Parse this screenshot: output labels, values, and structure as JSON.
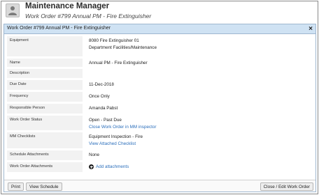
{
  "app": {
    "title": "Maintenance Manager",
    "subtitle": "Work Order #799 Annual PM - Fire Extinguisher"
  },
  "dialog": {
    "title": "Work Order #799 Annual PM - Fire Extinguisher",
    "close_label": "×"
  },
  "fields": {
    "equipment": {
      "label": "Equipment",
      "line1": "8080 Fire Extinguisher 01",
      "line2": "Department Facilities/Maintenance"
    },
    "name": {
      "label": "Name",
      "value": "Annual PM - Fire Extinguisher"
    },
    "description": {
      "label": "Description",
      "value": ""
    },
    "due_date": {
      "label": "Due Date",
      "value": "11-Dec-2018"
    },
    "frequency": {
      "label": "Frequency",
      "value": "Once Only"
    },
    "responsible_person": {
      "label": "Responsible Person",
      "value": "Amanda Pabst"
    },
    "work_order_status": {
      "label": "Work Order Status",
      "value": "Open - Past Due",
      "link": "Close Work Order in MM inspector"
    },
    "mm_checklists": {
      "label": "MM Checklists",
      "value": "Equipment Inspection - Fire",
      "link": "View Attached Checklist"
    },
    "schedule_attachments": {
      "label": "Schedule Attachments",
      "value": "None"
    },
    "work_order_attachments": {
      "label": "Work Order Attachments",
      "link": "Add attachments",
      "icon": "plus-circle-icon"
    }
  },
  "footer": {
    "print_label": "Print",
    "view_schedule_label": "View Schedule",
    "close_edit_label": "Close / Edit Work Order"
  }
}
